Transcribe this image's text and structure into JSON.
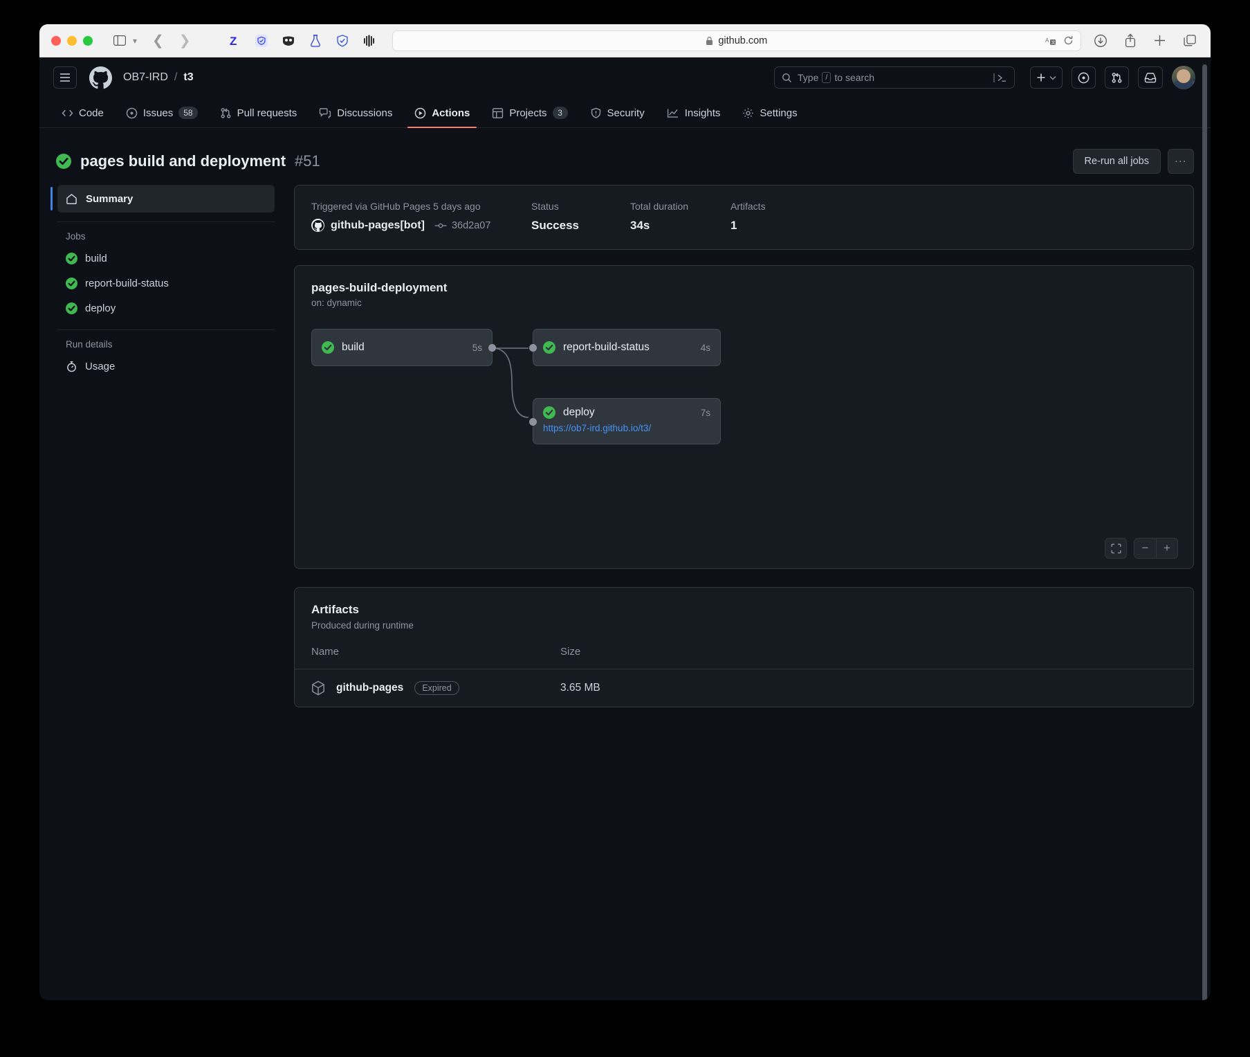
{
  "browser": {
    "url": "github.com",
    "secure_icon": "lock-icon",
    "extensions": [
      "zotero-icon",
      "shield-blue-icon",
      "mask-icon",
      "flask-icon",
      "adguard-shield-icon",
      "waveform-icon"
    ],
    "toolbar_right": [
      "download-icon",
      "share-icon",
      "new-tab-icon",
      "tab-overview-icon"
    ],
    "reader_icons": [
      "translate-icon",
      "reload-icon"
    ]
  },
  "gh_header": {
    "owner": "OB7-IRD",
    "separator": "/",
    "repo": "t3",
    "search_placeholder": "Type",
    "search_key": "/",
    "search_placeholder_tail": "to search"
  },
  "repo_nav": [
    {
      "label": "Code",
      "icon": "code-icon",
      "count": null,
      "active": false
    },
    {
      "label": "Issues",
      "icon": "issue-opened-icon",
      "count": "58",
      "active": false
    },
    {
      "label": "Pull requests",
      "icon": "git-pull-request-icon",
      "count": null,
      "active": false
    },
    {
      "label": "Discussions",
      "icon": "comment-discussion-icon",
      "count": null,
      "active": false
    },
    {
      "label": "Actions",
      "icon": "play-icon",
      "count": null,
      "active": true
    },
    {
      "label": "Projects",
      "icon": "table-icon",
      "count": "3",
      "active": false
    },
    {
      "label": "Security",
      "icon": "shield-icon",
      "count": null,
      "active": false
    },
    {
      "label": "Insights",
      "icon": "graph-icon",
      "count": null,
      "active": false
    },
    {
      "label": "Settings",
      "icon": "gear-icon",
      "count": null,
      "active": false
    }
  ],
  "run": {
    "status_icon": "check-circle-success-icon",
    "name": "pages build and deployment",
    "number": "#51",
    "rerun_label": "Re-run all jobs",
    "more_label": "..."
  },
  "sidebar": {
    "summary_label": "Summary",
    "jobs_header": "Jobs",
    "jobs": [
      {
        "label": "build",
        "status": "success"
      },
      {
        "label": "report-build-status",
        "status": "success"
      },
      {
        "label": "deploy",
        "status": "success"
      }
    ],
    "run_details_header": "Run details",
    "usage_label": "Usage"
  },
  "summary": {
    "triggered_text": "Triggered via GitHub Pages 5 days ago",
    "actor": "github-pages[bot]",
    "commit_sha": "36d2a07",
    "status_label": "Status",
    "status_value": "Success",
    "duration_label": "Total duration",
    "duration_value": "34s",
    "artifacts_label": "Artifacts",
    "artifacts_value": "1"
  },
  "workflow": {
    "name": "pages-build-deployment",
    "trigger": "on: dynamic",
    "nodes": [
      {
        "id": "build",
        "label": "build",
        "duration": "5s",
        "status": "success",
        "link": null
      },
      {
        "id": "report-build-status",
        "label": "report-build-status",
        "duration": "4s",
        "status": "success",
        "link": null
      },
      {
        "id": "deploy",
        "label": "deploy",
        "duration": "7s",
        "status": "success",
        "link": "https://ob7-ird.github.io/t3/"
      }
    ],
    "zoom_controls": {
      "fit": "fit-screen-icon",
      "zoom_out": "−",
      "zoom_in": "+"
    }
  },
  "artifacts": {
    "title": "Artifacts",
    "subtitle": "Produced during runtime",
    "col_name": "Name",
    "col_size": "Size",
    "rows": [
      {
        "name": "github-pages",
        "badge": "Expired",
        "size": "3.65 MB",
        "icon": "package-icon"
      }
    ]
  },
  "colors": {
    "success": "#3fb950",
    "accent": "#4493f8",
    "active_tab": "#f78166",
    "bg": "#0d1117",
    "card": "#161b22",
    "border": "#30363d"
  }
}
